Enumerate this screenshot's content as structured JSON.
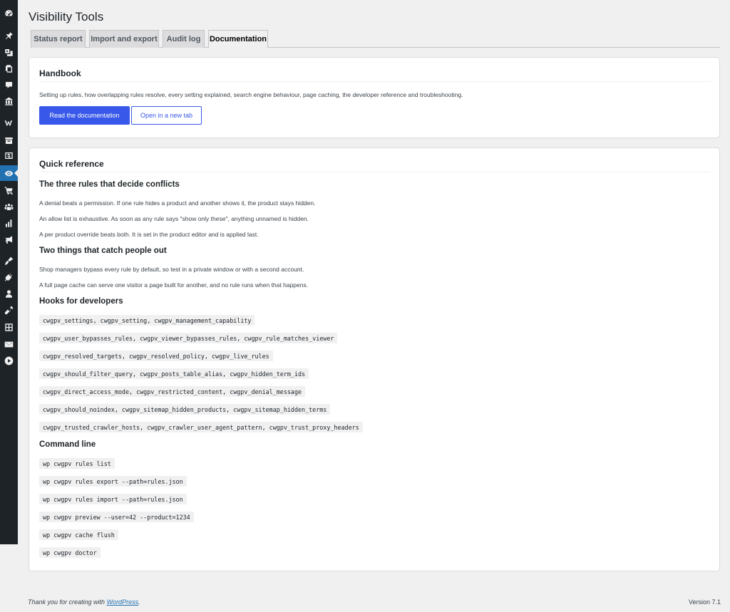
{
  "page": {
    "title": "Visibility Tools"
  },
  "tabs": [
    {
      "label": "Status report",
      "active": false
    },
    {
      "label": "Import and export",
      "active": false
    },
    {
      "label": "Audit log",
      "active": false
    },
    {
      "label": "Documentation",
      "active": true
    }
  ],
  "handbook": {
    "title": "Handbook",
    "description": "Setting up rules, how overlapping rules resolve, every setting explained, search engine behaviour, page caching, the developer reference and troubleshooting.",
    "primary_button": "Read the documentation",
    "secondary_button": "Open in a new tab"
  },
  "quick_reference": {
    "title": "Quick reference",
    "conflicts": {
      "heading": "The three rules that decide conflicts",
      "items": [
        "A denial beats a permission. If one rule hides a product and another shows it, the product stays hidden.",
        "An allow list is exhaustive. As soon as any rule says \"show only these\", anything unnamed is hidden.",
        "A per product override beats both. It is set in the product editor and is applied last."
      ]
    },
    "gotchas": {
      "heading": "Two things that catch people out",
      "items": [
        "Shop managers bypass every rule by default, so test in a private window or with a second account.",
        "A full page cache can serve one visitor a page built for another, and no rule runs when that happens."
      ]
    },
    "hooks": {
      "heading": "Hooks for developers",
      "items": [
        "cwgpv_settings, cwgpv_setting, cwgpv_management_capability",
        "cwgpv_user_bypasses_rules, cwgpv_viewer_bypasses_rules, cwgpv_rule_matches_viewer",
        "cwgpv_resolved_targets, cwgpv_resolved_policy, cwgpv_live_rules",
        "cwgpv_should_filter_query, cwgpv_posts_table_alias, cwgpv_hidden_term_ids",
        "cwgpv_direct_access_mode, cwgpv_restricted_content, cwgpv_denial_message",
        "cwgpv_should_noindex, cwgpv_sitemap_hidden_products, cwgpv_sitemap_hidden_terms",
        "cwgpv_trusted_crawler_hosts, cwgpv_crawler_user_agent_pattern, cwgpv_trust_proxy_headers"
      ]
    },
    "cli": {
      "heading": "Command line",
      "items": [
        "wp cwgpv rules list",
        "wp cwgpv rules export --path=rules.json",
        "wp cwgpv rules import --path=rules.json",
        "wp cwgpv preview --user=42 --product=1234",
        "wp cwgpv cache flush",
        "wp cwgpv doctor"
      ]
    }
  },
  "footer": {
    "thanks_prefix": "Thank you for creating with ",
    "thanks_link": "WordPress",
    "thanks_suffix": ".",
    "version": "Version 7.1"
  },
  "menu_icons": [
    "dashboard-icon",
    "pin-icon",
    "media-icon",
    "pages-icon",
    "comments-icon",
    "institution-icon",
    "woocommerce-icon",
    "archive-icon",
    "money-icon",
    "visibility-icon",
    "cart-icon",
    "groups-icon",
    "analytics-icon",
    "megaphone-icon",
    "appearance-icon",
    "plugins-icon",
    "users-icon",
    "tools-icon",
    "settings-icon",
    "mail-icon",
    "play-icon"
  ]
}
